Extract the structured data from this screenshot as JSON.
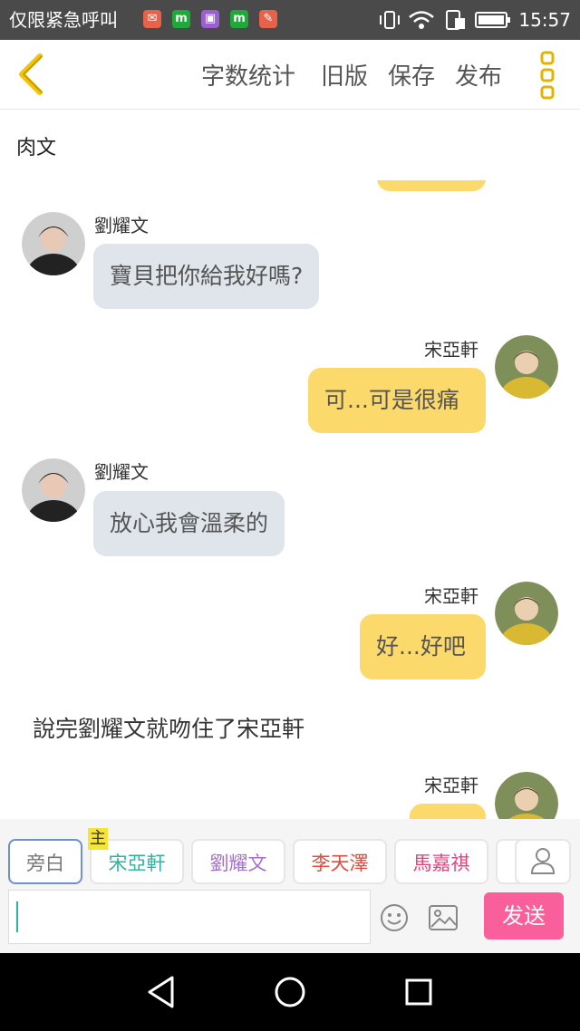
{
  "status_bar": {
    "notification_text": "仅限紧急呼叫",
    "time": "15:57",
    "notification_icons": [
      "mail-icon",
      "app-m-icon",
      "gallery-icon",
      "app-m-icon",
      "tool-icon"
    ]
  },
  "header": {
    "word_count_label": "字数统计",
    "old_version_label": "旧版",
    "save_label": "保存",
    "publish_label": "发布"
  },
  "document": {
    "title": "肉文"
  },
  "chat": {
    "messages": [
      {
        "speaker": "劉耀文",
        "side": "left",
        "text": "寶貝把你給我好嗎?"
      },
      {
        "speaker": "宋亞軒",
        "side": "right",
        "text": "可...可是很痛"
      },
      {
        "speaker": "劉耀文",
        "side": "left",
        "text": "放心我會溫柔的"
      },
      {
        "speaker": "宋亞軒",
        "side": "right",
        "text": "好...好吧"
      },
      {
        "type": "narration",
        "text": "說完劉耀文就吻住了宋亞軒"
      },
      {
        "speaker": "宋亞軒",
        "side": "right",
        "text": ""
      }
    ]
  },
  "roles": {
    "main_badge": "主",
    "items": [
      {
        "label": "旁白",
        "color": "#777777"
      },
      {
        "label": "宋亞軒",
        "color": "#2bb3a3"
      },
      {
        "label": "劉耀文",
        "color": "#a56ed0"
      },
      {
        "label": "李天澤",
        "color": "#e04b3c"
      },
      {
        "label": "馬嘉祺",
        "color": "#e0457c"
      }
    ]
  },
  "composer": {
    "input_value": "",
    "send_label": "发送"
  },
  "colors": {
    "accent": "#f5c400",
    "send": "#f85f9b",
    "bubble_right": "#fcd96b",
    "bubble_left": "#e0e5ec"
  }
}
